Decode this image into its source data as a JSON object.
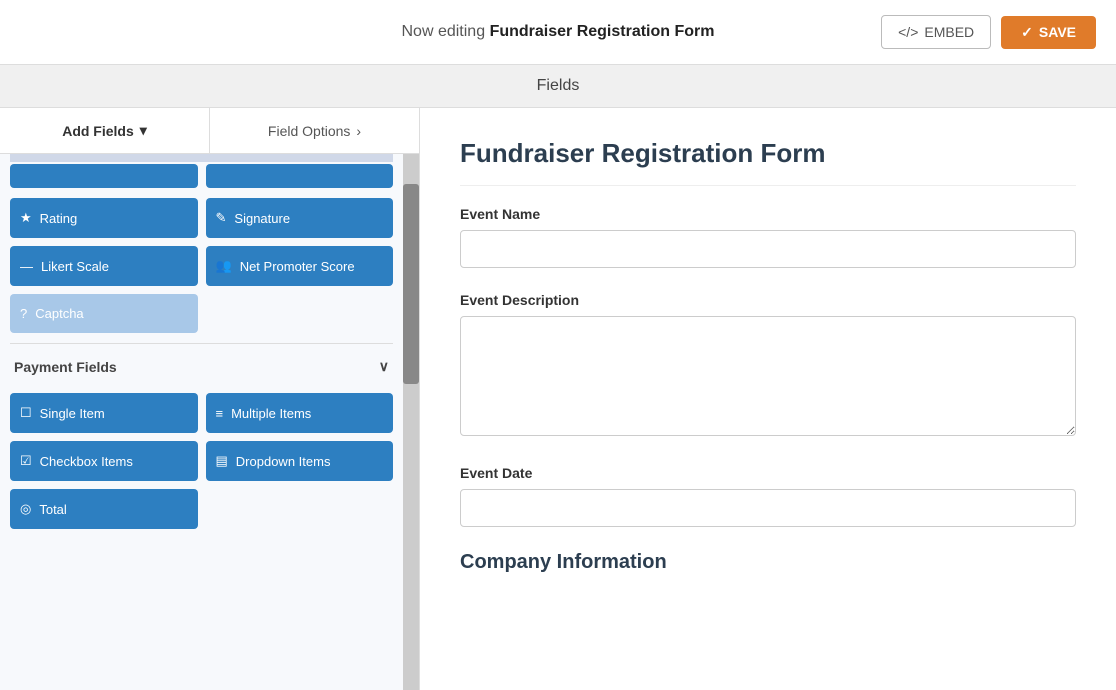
{
  "header": {
    "editing_label": "Now editing",
    "form_name": "Fundraiser Registration Form",
    "embed_label": "EMBED",
    "save_label": "SAVE"
  },
  "fields_header": {
    "label": "Fields"
  },
  "left_panel": {
    "tab_add": "Add Fields",
    "tab_options": "Field Options",
    "field_buttons": [
      {
        "id": "rating",
        "label": "Rating",
        "icon": "★"
      },
      {
        "id": "signature",
        "label": "Signature",
        "icon": "✎"
      },
      {
        "id": "likert-scale",
        "label": "Likert Scale",
        "icon": "—"
      },
      {
        "id": "net-promoter-score",
        "label": "Net Promoter Score",
        "icon": "👥"
      },
      {
        "id": "captcha",
        "label": "Captcha",
        "icon": "?"
      }
    ],
    "payment_section": "Payment Fields",
    "payment_buttons": [
      {
        "id": "single-item",
        "label": "Single Item",
        "icon": "☐"
      },
      {
        "id": "multiple-items",
        "label": "Multiple Items",
        "icon": "≡"
      },
      {
        "id": "checkbox-items",
        "label": "Checkbox Items",
        "icon": "☑"
      },
      {
        "id": "dropdown-items",
        "label": "Dropdown Items",
        "icon": "▤"
      },
      {
        "id": "total",
        "label": "Total",
        "icon": "◎"
      }
    ]
  },
  "form": {
    "title": "Fundraiser Registration Form",
    "fields": [
      {
        "id": "event-name",
        "label": "Event Name",
        "type": "input"
      },
      {
        "id": "event-description",
        "label": "Event Description",
        "type": "textarea"
      },
      {
        "id": "event-date",
        "label": "Event Date",
        "type": "input"
      }
    ],
    "section_title": "Company Information"
  }
}
